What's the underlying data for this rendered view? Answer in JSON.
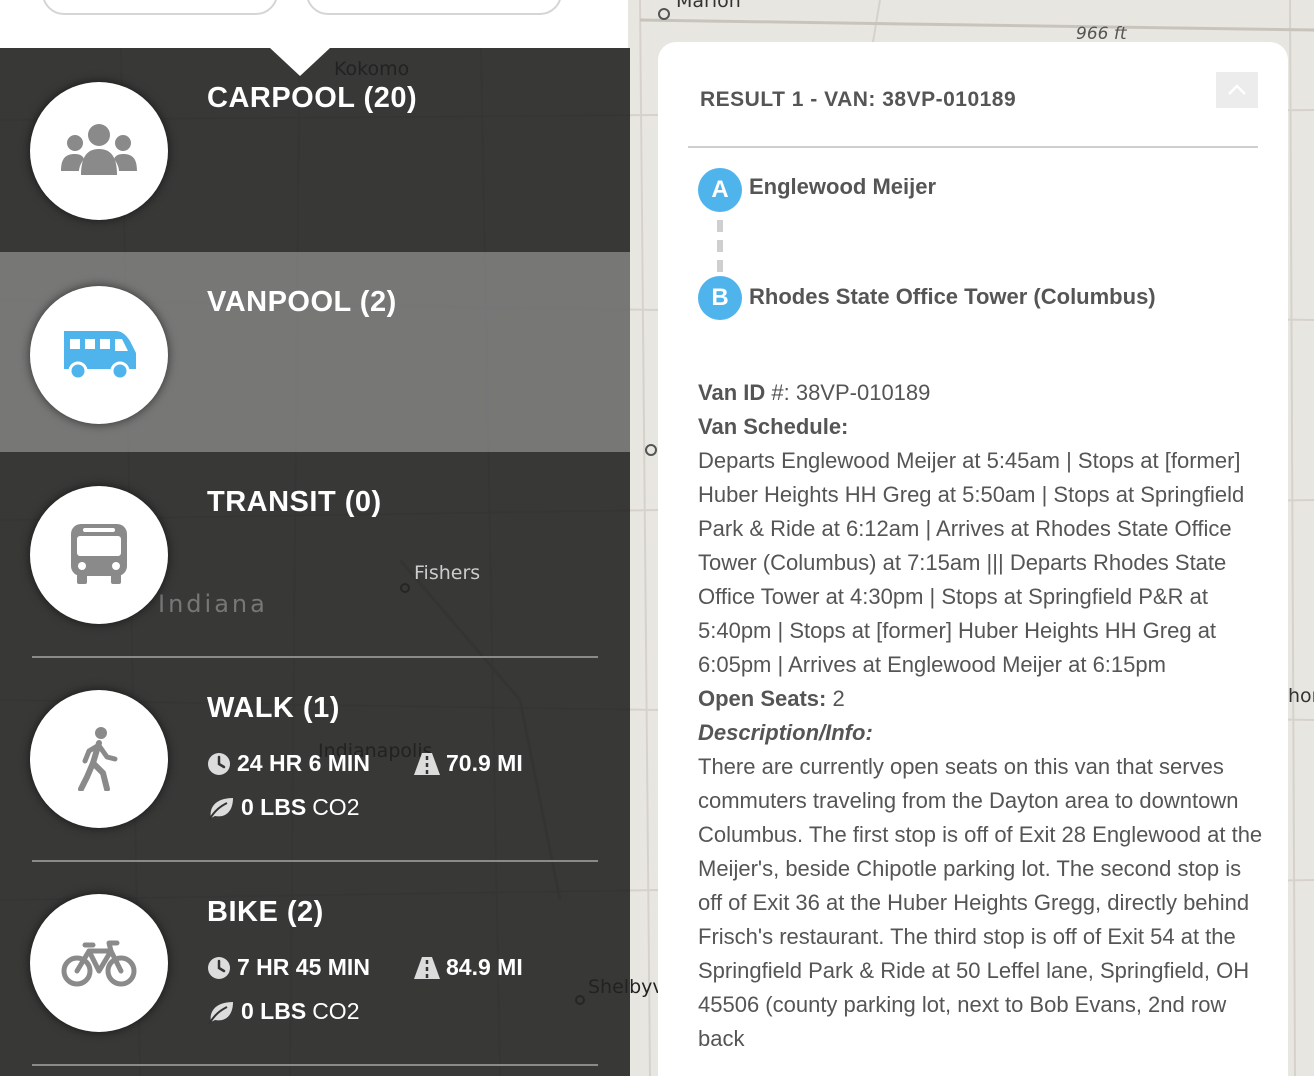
{
  "map": {
    "labels": {
      "marion": "Marion",
      "elevation": "966 ft",
      "kokomo": "Kokomo",
      "fishers": "Fishers",
      "indiana": "Indiana",
      "indianapolis": "Indianapolis",
      "shelbyville": "Shelbyv",
      "right_edge": "hor"
    }
  },
  "modes": [
    {
      "title": "CARPOOL (20)",
      "icon": "people-icon"
    },
    {
      "title": "VANPOOL (2)",
      "icon": "van-icon",
      "selected": true
    },
    {
      "title": "TRANSIT (0)",
      "icon": "bus-icon"
    },
    {
      "title": "WALK (1)",
      "icon": "walking-person-icon",
      "time": "24 HR 6 MIN",
      "distance": "70.9 MI",
      "co2_value": "0 LBS",
      "co2_unit": "CO2"
    },
    {
      "title": "BIKE (2)",
      "icon": "bicycle-icon",
      "time": "7 HR 45 MIN",
      "distance": "84.9 MI",
      "co2_value": "0 LBS",
      "co2_unit": "CO2"
    }
  ],
  "result": {
    "header": "RESULT 1 - VAN: 38VP-010189",
    "origin_marker": "A",
    "origin": "Englewood Meijer",
    "destination_marker": "B",
    "destination": "Rhodes State Office Tower (Columbus)",
    "van_id_label": "Van ID",
    "van_id_suffix": " #: ",
    "van_id": "38VP-010189",
    "schedule_label": "Van Schedule:",
    "schedule": "Departs Englewood Meijer at 5:45am | Stops at [former] Huber Heights HH Greg at 5:50am | Stops at Springfield Park & Ride at 6:12am | Arrives at Rhodes State Office Tower (Columbus) at 7:15am ||| Departs Rhodes State Office Tower at 4:30pm | Stops at Springfield P&R at 5:40pm | Stops at [former] Huber Heights HH Greg at 6:05pm | Arrives at Englewood Meijer at 6:15pm",
    "seats_label": "Open Seats:",
    "seats": " 2",
    "description_label": "Description/Info:",
    "description": "There are currently open seats on this van that serves commuters traveling from the Dayton area to downtown Columbus. The first stop is off of Exit 28 Englewood at the Meijer's, beside Chipotle parking lot. The second stop is off of Exit 36 at the Huber Heights Gregg, directly behind Frisch's restaurant. The third stop is off of Exit 54 at the Springfield Park & Ride at 50 Leffel lane, Springfield, OH 45506 (county parking lot, next to Bob Evans, 2nd row back"
  },
  "colors": {
    "marker": "#4fb3ec",
    "van_icon": "#4fb3ec",
    "panel": "#1e1e1e",
    "selected_row": "#808080"
  }
}
